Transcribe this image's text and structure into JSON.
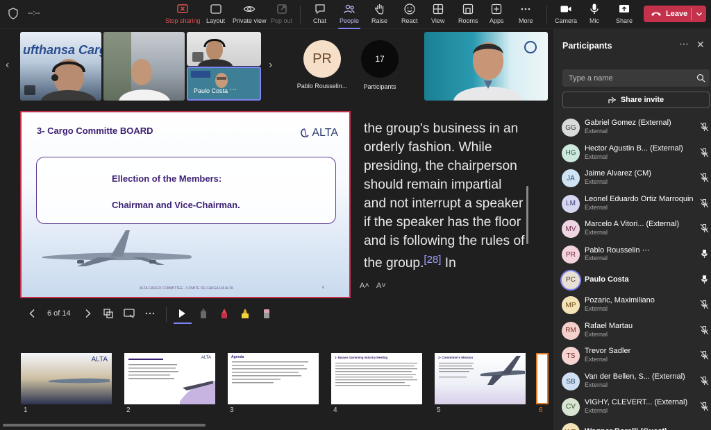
{
  "toolbar": {
    "timer": "--:--",
    "stop_sharing": "Stop sharing",
    "layout": "Layout",
    "private_view": "Private view",
    "pop_out": "Pop out",
    "chat": "Chat",
    "people": "People",
    "raise": "Raise",
    "react": "React",
    "view": "View",
    "rooms": "Rooms",
    "apps": "Apps",
    "more": "More",
    "camera": "Camera",
    "mic": "Mic",
    "share": "Share",
    "leave": "Leave"
  },
  "video_strip": {
    "tile_name_paulo": "Paulo Costa",
    "avatar_pr_initials": "PR",
    "avatar_pr_label": "Pablo Rousselin...",
    "participants_count": "17",
    "participants_label": "Participants"
  },
  "slide": {
    "title": "3- Cargo Committe BOARD",
    "logo": "ALTA",
    "line1": "Ellection of the Members:",
    "line2": "Chairman and Vice-Chairman.",
    "footer": "ALTA CARGO COMMITTEE - COMITE DE CARGA DA ALTA",
    "page": "6"
  },
  "notes": {
    "text": "the group's business in an orderly fashion. While presiding, the chairperson should remain impartial and not interrupt a speaker if the speaker has the floor and is following the rules of the group.",
    "ref": "[28]",
    "tail": "In",
    "font_up": "A˄",
    "font_down": "A˅"
  },
  "controls": {
    "page_indicator": "6 of 14"
  },
  "thumbnails": [
    {
      "num": "1",
      "heading": "ALTA"
    },
    {
      "num": "2",
      "heading": "ALTA"
    },
    {
      "num": "3",
      "heading": "Agenda"
    },
    {
      "num": "4",
      "heading": "1- Bylaws Governing Industry Meeting"
    },
    {
      "num": "5",
      "heading": "2- Committee's Mission"
    },
    {
      "num": "6",
      "heading": ""
    }
  ],
  "participants_panel": {
    "title": "Participants",
    "search_placeholder": "Type a name",
    "share_invite": "Share invite",
    "people": [
      {
        "initials": "GG",
        "name": "Gabriel Gomez (External)",
        "sub": "External",
        "bg": "#d9dbdb",
        "fg": "#3a3a3a",
        "mic": "muted"
      },
      {
        "initials": "HG",
        "name": "Hector Agustin B... (External)",
        "sub": "External",
        "bg": "#cde8dd",
        "fg": "#2e5b48",
        "mic": "muted"
      },
      {
        "initials": "JA",
        "name": "Jaime Alvarez (CM)",
        "sub": "External",
        "bg": "#cfe3f2",
        "fg": "#2b4d6b",
        "mic": "muted"
      },
      {
        "initials": "LM",
        "name": "Leonel Eduardo Ortiz Marroquin",
        "sub": "External",
        "bg": "#d6d6f0",
        "fg": "#3b3b7a",
        "mic": "muted"
      },
      {
        "initials": "MV",
        "name": "Marcelo A Vitori...  (External)",
        "sub": "External",
        "bg": "#eed5e2",
        "fg": "#6e2f50",
        "mic": "muted"
      },
      {
        "initials": "PR",
        "name": "Pablo Rousselin ⋯",
        "sub": "External",
        "bg": "#f3d3dc",
        "fg": "#7c2840",
        "mic": "on"
      },
      {
        "initials": "PC",
        "name": "Paulo Costa",
        "sub": "",
        "bg": "#e8dfd5",
        "fg": "#4a3a2a",
        "mic": "on"
      },
      {
        "initials": "MP",
        "name": "Pozaric, Maximiliano",
        "sub": "External",
        "bg": "#f5e3b8",
        "fg": "#6a4d10",
        "mic": "muted"
      },
      {
        "initials": "RM",
        "name": "Rafael Martau",
        "sub": "External",
        "bg": "#f3d0cb",
        "fg": "#7a2e22",
        "mic": "muted"
      },
      {
        "initials": "TS",
        "name": "Trevor Sadler",
        "sub": "External",
        "bg": "#f5d5d2",
        "fg": "#7a2e2a",
        "mic": "muted"
      },
      {
        "initials": "SB",
        "name": "Van der Bellen, S... (External)",
        "sub": "External",
        "bg": "#cfe0f2",
        "fg": "#2b4d6b",
        "mic": "muted"
      },
      {
        "initials": "CV",
        "name": "VIGHY, CLEVERT...  (External)",
        "sub": "External",
        "bg": "#d9e5d3",
        "fg": "#35502a",
        "mic": "muted"
      },
      {
        "initials": "WB",
        "name": "Wagner Borelli (Guest)",
        "sub": "",
        "bg": "#f5e3b8",
        "fg": "#6a4d10",
        "mic": ""
      }
    ]
  }
}
